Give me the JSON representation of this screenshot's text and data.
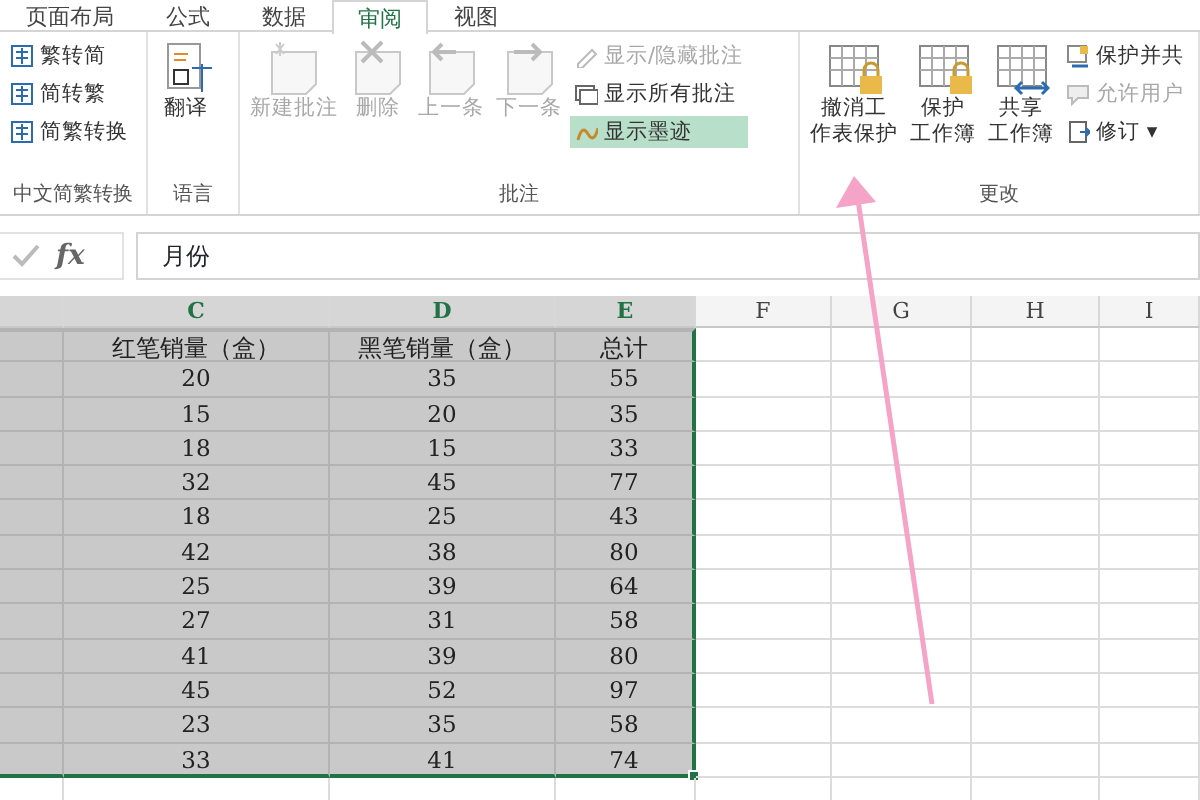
{
  "ribbon_tabs": [
    {
      "label": "页面布局",
      "selected": false
    },
    {
      "label": "公式",
      "selected": false
    },
    {
      "label": "数据",
      "selected": false
    },
    {
      "label": "审阅",
      "selected": true
    },
    {
      "label": "视图",
      "selected": false
    }
  ],
  "ribbon_groups": [
    {
      "label": "中文简繁转换",
      "items": [
        {
          "kind": "small",
          "label": "繁转简",
          "disabled": false,
          "selected": false
        },
        {
          "kind": "small",
          "label": "简转繁",
          "disabled": false,
          "selected": false
        },
        {
          "kind": "small",
          "label": "简繁转换",
          "disabled": false,
          "selected": false
        }
      ]
    },
    {
      "label": "语言",
      "items": [
        {
          "kind": "large",
          "label": "翻译",
          "disabled": false
        }
      ]
    },
    {
      "label": "批注",
      "items": [
        {
          "kind": "large",
          "label": "新建批注",
          "disabled": true
        },
        {
          "kind": "large",
          "label": "删除",
          "disabled": true
        },
        {
          "kind": "large",
          "label": "上一条",
          "disabled": true
        },
        {
          "kind": "large",
          "label": "下一条",
          "disabled": true
        },
        {
          "kind": "small",
          "label": "显示/隐藏批注",
          "disabled": true,
          "selected": false
        },
        {
          "kind": "small",
          "label": "显示所有批注",
          "disabled": false,
          "selected": false
        },
        {
          "kind": "small",
          "label": "显示墨迹",
          "disabled": false,
          "selected": true
        }
      ]
    },
    {
      "label": "更改",
      "items": [
        {
          "kind": "large",
          "lines": [
            "撤消工",
            "作表保护"
          ],
          "disabled": false
        },
        {
          "kind": "large",
          "lines": [
            "保护",
            "工作簿"
          ],
          "disabled": false
        },
        {
          "kind": "large",
          "lines": [
            "共享",
            "工作簿"
          ],
          "disabled": false
        },
        {
          "kind": "small",
          "label": "保护并共",
          "disabled": false,
          "selected": false
        },
        {
          "kind": "small",
          "label": "允许用户",
          "disabled": true,
          "selected": false
        },
        {
          "kind": "small",
          "label": "修订 ▾",
          "disabled": false,
          "selected": false
        }
      ]
    }
  ],
  "formula_bar": {
    "function_label": "fx",
    "value": "月份"
  },
  "sheet": {
    "columns": [
      {
        "label": "C",
        "selected": true
      },
      {
        "label": "D",
        "selected": true
      },
      {
        "label": "E",
        "selected": true
      },
      {
        "label": "F",
        "selected": false
      },
      {
        "label": "G",
        "selected": false
      },
      {
        "label": "H",
        "selected": false
      },
      {
        "label": "I",
        "selected": false
      }
    ],
    "rows": [
      [
        "红笔销量（盒）",
        "黑笔销量（盒）",
        "总计"
      ],
      [
        "20",
        "35",
        "55"
      ],
      [
        "15",
        "20",
        "35"
      ],
      [
        "18",
        "15",
        "33"
      ],
      [
        "32",
        "45",
        "77"
      ],
      [
        "18",
        "25",
        "43"
      ],
      [
        "42",
        "38",
        "80"
      ],
      [
        "25",
        "39",
        "64"
      ],
      [
        "27",
        "31",
        "58"
      ],
      [
        "41",
        "39",
        "80"
      ],
      [
        "45",
        "52",
        "97"
      ],
      [
        "23",
        "35",
        "58"
      ],
      [
        "33",
        "41",
        "74"
      ]
    ]
  }
}
